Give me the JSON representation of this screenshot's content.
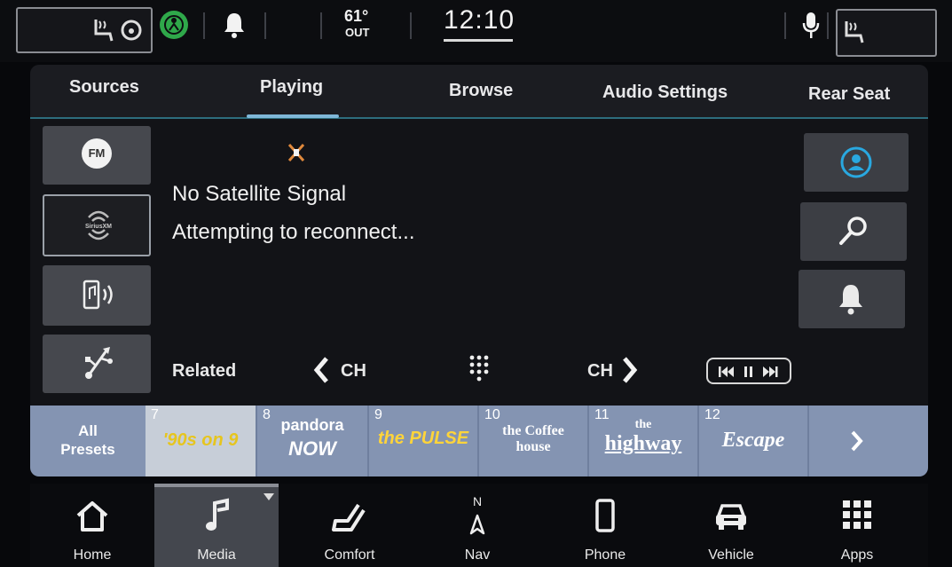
{
  "status_bar": {
    "temperature": "61°",
    "temperature_sub": "OUT",
    "time": "12:10"
  },
  "tabs": [
    "Sources",
    "Playing",
    "Browse",
    "Audio Settings",
    "Rear Seat"
  ],
  "sources": {
    "fm_label": "FM",
    "siriusxm_label": "SiriusXM"
  },
  "now_playing": {
    "line1": "No Satellite Signal",
    "line2": "Attempting to reconnect..."
  },
  "controls": {
    "related": "Related",
    "ch_prev": "CH",
    "ch_next": "CH"
  },
  "presets": {
    "all_label_1": "All",
    "all_label_2": "Presets",
    "items": [
      {
        "num": "7",
        "logo": "'90s on 9"
      },
      {
        "num": "8",
        "logo_1": "pandora",
        "logo_2": "NOW"
      },
      {
        "num": "9",
        "logo": "the PULSE"
      },
      {
        "num": "10",
        "logo_1": "the Coffee",
        "logo_2": "house"
      },
      {
        "num": "11",
        "logo_1": "the",
        "logo_2": "highway"
      },
      {
        "num": "12",
        "logo": "Escape"
      }
    ]
  },
  "dock": [
    {
      "label": "Home"
    },
    {
      "label": "Media"
    },
    {
      "label": "Comfort"
    },
    {
      "label": "Nav",
      "sub": "N"
    },
    {
      "label": "Phone"
    },
    {
      "label": "Vehicle"
    },
    {
      "label": "Apps"
    }
  ],
  "colors": {
    "accent": "#7fb7d8",
    "preset_bar": "#8494b2",
    "active_preset": "#c7ced8",
    "green_icon": "#2fa84a",
    "user_icon": "#29a8e0"
  }
}
